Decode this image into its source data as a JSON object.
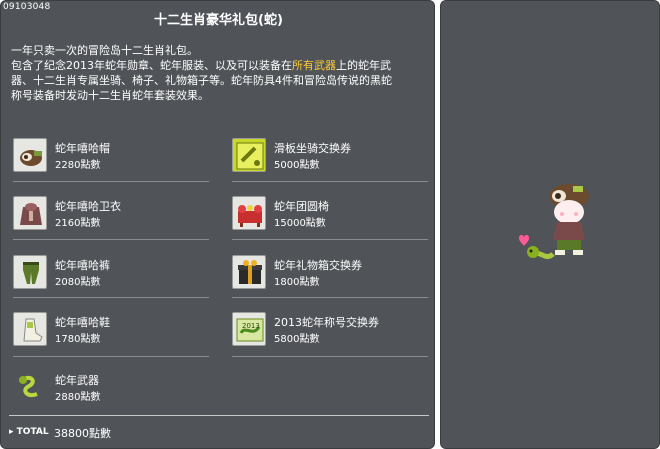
{
  "item_code": "09103048",
  "title": "十二生肖豪华礼包(蛇)",
  "description": {
    "line1": "一年只卖一次的冒险岛十二生肖礼包。",
    "line2_pre": "包含了纪念2013年蛇年勋章、蛇年服装、以及可以装备在",
    "line2_highlight": "所有武器",
    "line2_post": "上的蛇年武",
    "line3": "器、十二生肖专属坐骑、椅子、礼物箱子等。蛇年防具4件和冒险岛传说的黑蛇",
    "line4": "称号装备时发动十二生肖蛇年套装效果。"
  },
  "items_left": [
    {
      "name": "蛇年嘻哈帽",
      "price": "2280點數",
      "icon": "hat-icon"
    },
    {
      "name": "蛇年嘻哈卫衣",
      "price": "2160點數",
      "icon": "hoodie-icon"
    },
    {
      "name": "蛇年嘻哈裤",
      "price": "2080點數",
      "icon": "pants-icon"
    },
    {
      "name": "蛇年嘻哈鞋",
      "price": "1780點數",
      "icon": "shoes-icon"
    },
    {
      "name": "蛇年武器",
      "price": "2880點數",
      "icon": "snake-weapon-icon"
    }
  ],
  "items_right": [
    {
      "name": "滑板坐骑交换券",
      "price": "5000點數",
      "icon": "skateboard-coupon-icon"
    },
    {
      "name": "蛇年团圆椅",
      "price": "15000點數",
      "icon": "chair-icon"
    },
    {
      "name": "蛇年礼物箱交换券",
      "price": "1800點數",
      "icon": "gift-box-icon"
    },
    {
      "name": "2013蛇年称号交换券",
      "price": "5800點數",
      "icon": "title-coupon-icon"
    }
  ],
  "total": {
    "label": "TOTAL",
    "value": "38800點數"
  }
}
